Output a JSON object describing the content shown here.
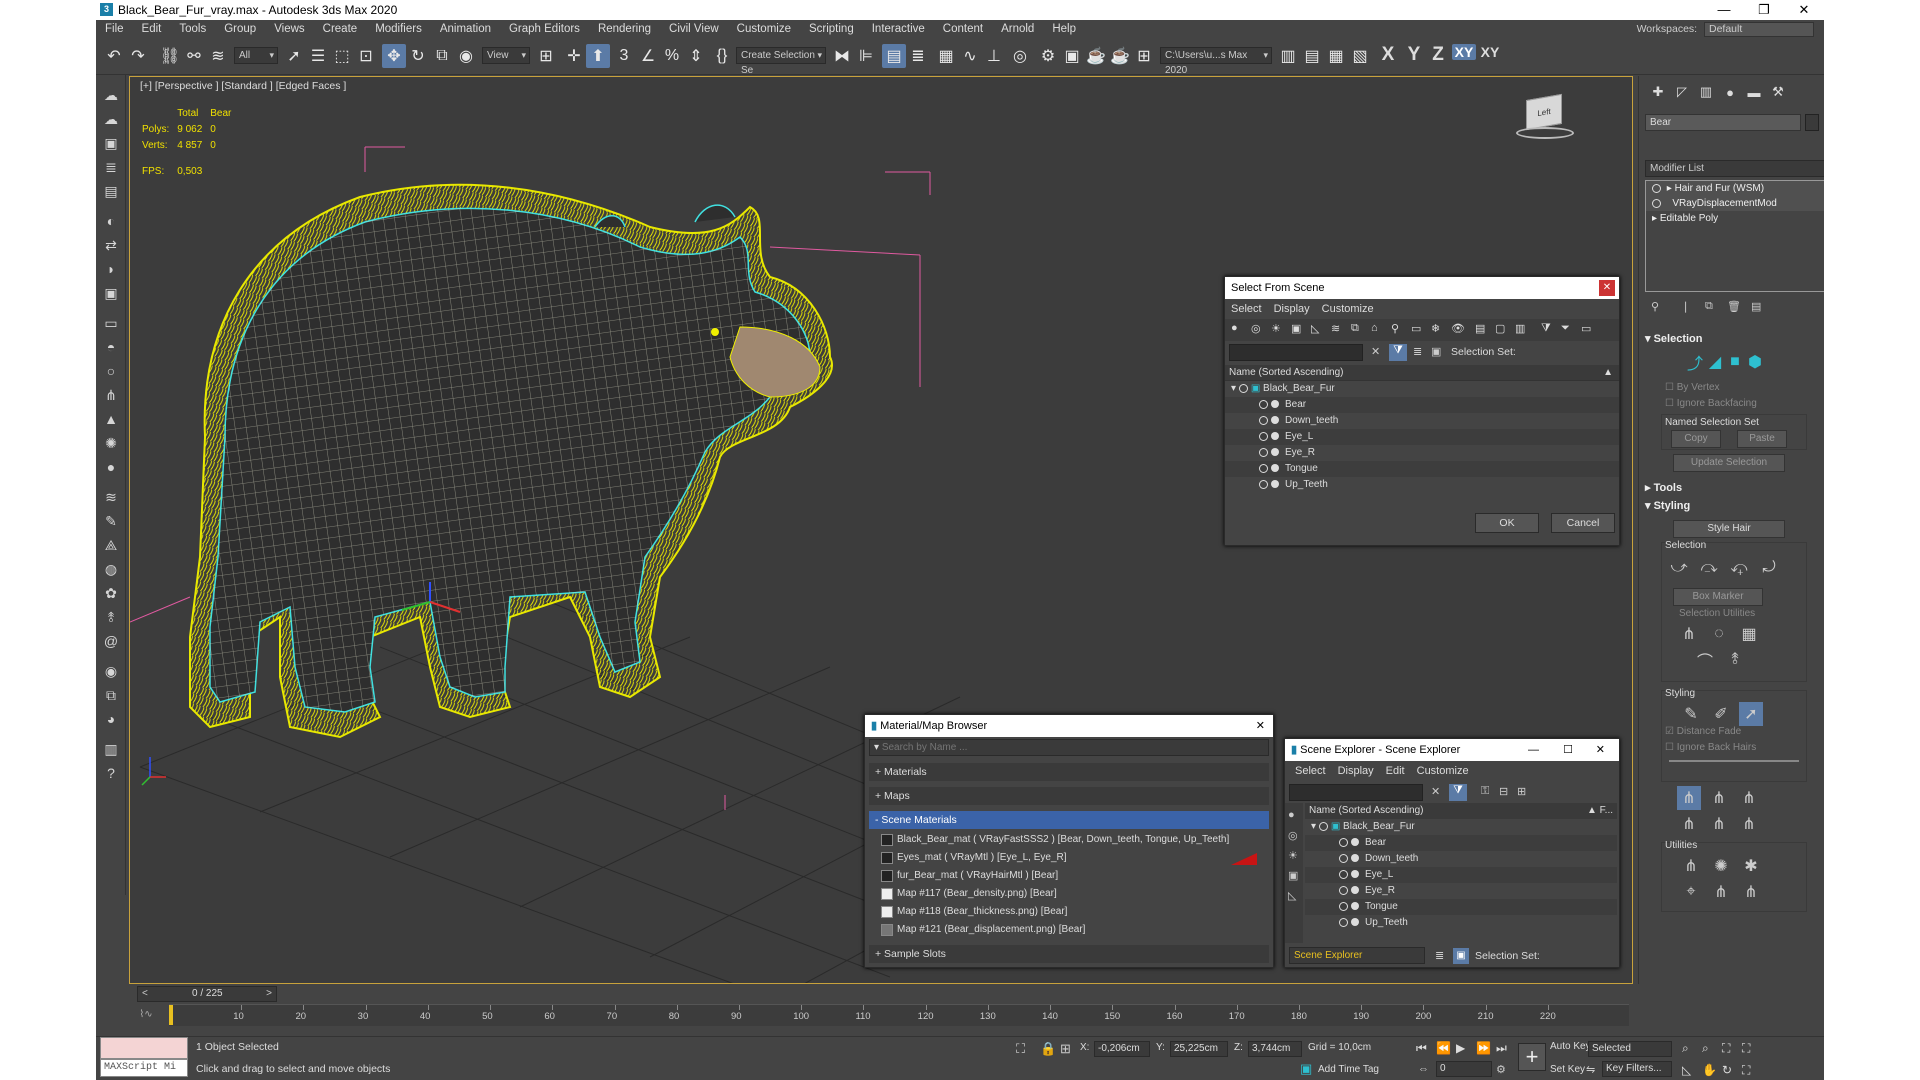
{
  "window": {
    "title": "Black_Bear_Fur_vray.max - Autodesk 3ds Max 2020",
    "logo": "3",
    "min": "—",
    "max": "❐",
    "close": "✕"
  },
  "menu": [
    "File",
    "Edit",
    "Tools",
    "Group",
    "Views",
    "Create",
    "Modifiers",
    "Animation",
    "Graph Editors",
    "Rendering",
    "Civil View",
    "Customize",
    "Scripting",
    "Interactive",
    "Content",
    "Arnold",
    "Help"
  ],
  "workspace": {
    "label": "Workspaces:",
    "value": "Default"
  },
  "toolbar": {
    "filter_value": "All",
    "refcoord_value": "View",
    "selection_set_value": "Create Selection Se",
    "path_value": "C:\\Users\\u...s Max 2020",
    "axes": [
      "X",
      "Y",
      "Z",
      "XY",
      "XY"
    ]
  },
  "viewport": {
    "label": "[+] [Perspective ] [Standard ] [Edged Faces ]",
    "stats": {
      "col_total": "Total",
      "col_sel": "Bear",
      "polys_label": "Polys:",
      "polys_total": "9 062",
      "polys_sel": "0",
      "verts_label": "Verts:",
      "verts_total": "4 857",
      "verts_sel": "0",
      "fps_label": "FPS:",
      "fps_value": "0,503"
    },
    "viewcube_label": "Left"
  },
  "command_panel": {
    "object_name": "Bear",
    "modifier_list": "Modifier List",
    "stack": [
      "Hair and Fur (WSM)",
      "VRayDisplacementMod",
      "Editable Poly"
    ],
    "selection": {
      "title": "Selection",
      "by_vertex": "By Vertex",
      "ignore_backfacing": "Ignore Backfacing",
      "named_sel_set": "Named Selection Set",
      "copy": "Copy",
      "paste": "Paste",
      "update_selection": "Update Selection"
    },
    "tools": {
      "title": "Tools"
    },
    "styling": {
      "title": "Styling",
      "style_hair": "Style Hair",
      "selection_label": "Selection",
      "box_marker": "Box Marker",
      "selection_utilities": "Selection Utilities",
      "styling_label": "Styling",
      "distance_fade": "Distance Fade",
      "ignore_back_hairs": "Ignore Back Hairs",
      "utilities": "Utilities"
    }
  },
  "select_from_scene": {
    "title": "Select From Scene",
    "menu": [
      "Select",
      "Display",
      "Customize"
    ],
    "selection_set": "Selection Set:",
    "column": "Name (Sorted Ascending)",
    "root": "Black_Bear_Fur",
    "children": [
      "Bear",
      "Down_teeth",
      "Eye_L",
      "Eye_R",
      "Tongue",
      "Up_Teeth"
    ],
    "ok": "OK",
    "cancel": "Cancel"
  },
  "material_browser": {
    "title": "Material/Map Browser",
    "search_placeholder": "Search by Name ...",
    "sections": {
      "materials": "+ Materials",
      "maps": "+ Maps",
      "scene_materials": "- Scene Materials",
      "sample_slots": "+ Sample Slots"
    },
    "items": [
      "Black_Bear_mat  ( VRayFastSSS2 ) [Bear, Down_teeth, Tongue, Up_Teeth]",
      "Eyes_mat  ( VRayMtl ) [Eye_L, Eye_R]",
      "fur_Bear_mat  ( VRayHairMtl ) [Bear]",
      "Map #117 (Bear_density.png)  [Bear]",
      "Map #118 (Bear_thickness.png)  [Bear]",
      "Map #121 (Bear_displacement.png)  [Bear]"
    ]
  },
  "scene_explorer": {
    "title": "Scene Explorer - Scene Explorer",
    "menu": [
      "Select",
      "Display",
      "Edit",
      "Customize"
    ],
    "column": "Name (Sorted Ascending)",
    "column_right": "▲ F...",
    "root": "Black_Bear_Fur",
    "children": [
      "Bear",
      "Down_teeth",
      "Eye_L",
      "Eye_R",
      "Tongue",
      "Up_Teeth"
    ],
    "footer_name": "Scene Explorer",
    "selection_set": "Selection Set:"
  },
  "timeline": {
    "frame": "0 / 225",
    "ticks": [
      "10",
      "20",
      "30",
      "40",
      "50",
      "60",
      "70",
      "80",
      "90",
      "100",
      "110",
      "120",
      "130",
      "140",
      "150",
      "160",
      "170",
      "180",
      "190",
      "200",
      "210",
      "220"
    ],
    "total_frames": 225
  },
  "status": {
    "maxscript": "MAXScript Mi",
    "selected": "1 Object Selected",
    "prompt": "Click and drag to select and move objects",
    "x_label": "X:",
    "x_value": "-0,206cm",
    "y_label": "Y:",
    "y_value": "25,225cm",
    "z_label": "Z:",
    "z_value": "3,744cm",
    "grid": "Grid = 10,0cm",
    "add_time_tag": "Add Time Tag",
    "auto_key": "Auto Key",
    "set_key": "Set Key",
    "key_mode": "Selected",
    "frame_field": "0",
    "key_filters": "Key Filters..."
  },
  "colors": {
    "accent": "#5b7ba6",
    "fur": "#f0f000",
    "wire": "#ffffff",
    "outline": "#40e0e0",
    "bbox": "#e05aa0"
  }
}
